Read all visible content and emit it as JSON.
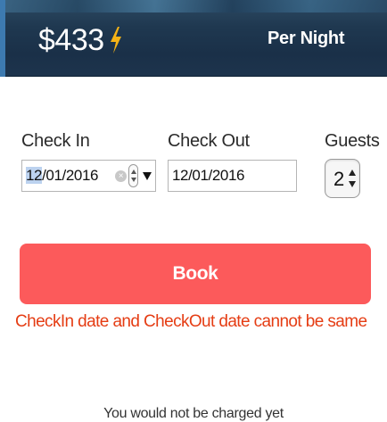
{
  "header": {
    "price": "$433",
    "per_night": "Per Night",
    "icon": "lightning-bolt-icon"
  },
  "form": {
    "checkin_label": "Check In",
    "checkin_value_highlight": "12",
    "checkin_value_rest": "/01/2016",
    "checkout_label": "Check Out",
    "checkout_value": "12/01/2016",
    "guests_label": "Guests",
    "guests_value": "2"
  },
  "book_label": "Book",
  "error_message": "CheckIn date and CheckOut date cannot be same",
  "footer_note": "You would not be charged yet",
  "colors": {
    "accent": "#fc5a5b",
    "error": "#e53d14",
    "bolt": "#f5b316",
    "header_bg": "#1f3850"
  }
}
